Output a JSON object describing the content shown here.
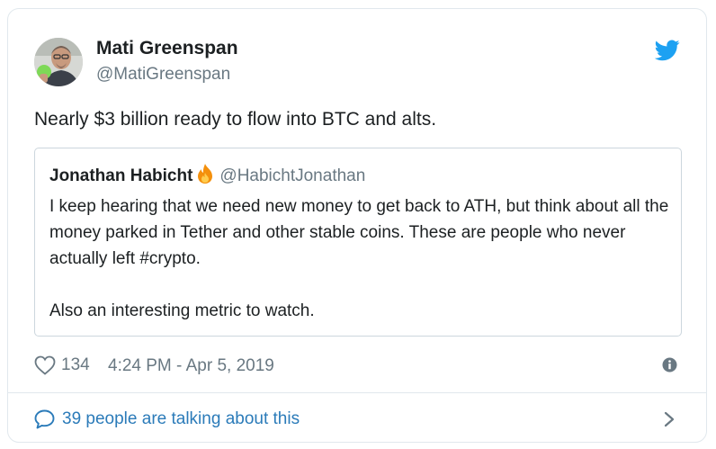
{
  "tweet": {
    "author": {
      "display_name": "Mati Greenspan",
      "handle": "@MatiGreenspan"
    },
    "text": "Nearly $3 billion ready to flow into BTC and alts.",
    "quoted": {
      "display_name": "Jonathan Habicht",
      "name_emoji": "fire-icon",
      "handle": "@HabichtJonathan",
      "paragraphs": [
        "I keep hearing that we need new money to get back to ATH, but think about all the money parked in Tether and other stable coins. These are people who never actually left #crypto.",
        "Also an interesting metric to watch."
      ]
    },
    "likes": "134",
    "timestamp": "4:24 PM - Apr 5, 2019",
    "footer_text": "39 people are talking about this"
  },
  "icons": {
    "brand": "twitter-bird-icon",
    "like": "heart-icon",
    "info": "info-icon",
    "comment": "comment-icon",
    "footer_arrow": "chevron-right-icon"
  },
  "colors": {
    "twitter_blue": "#1da1f2",
    "link_blue": "#2b7bb9",
    "text": "#1c2022",
    "muted": "#697882",
    "border": "#e1e8ed"
  }
}
